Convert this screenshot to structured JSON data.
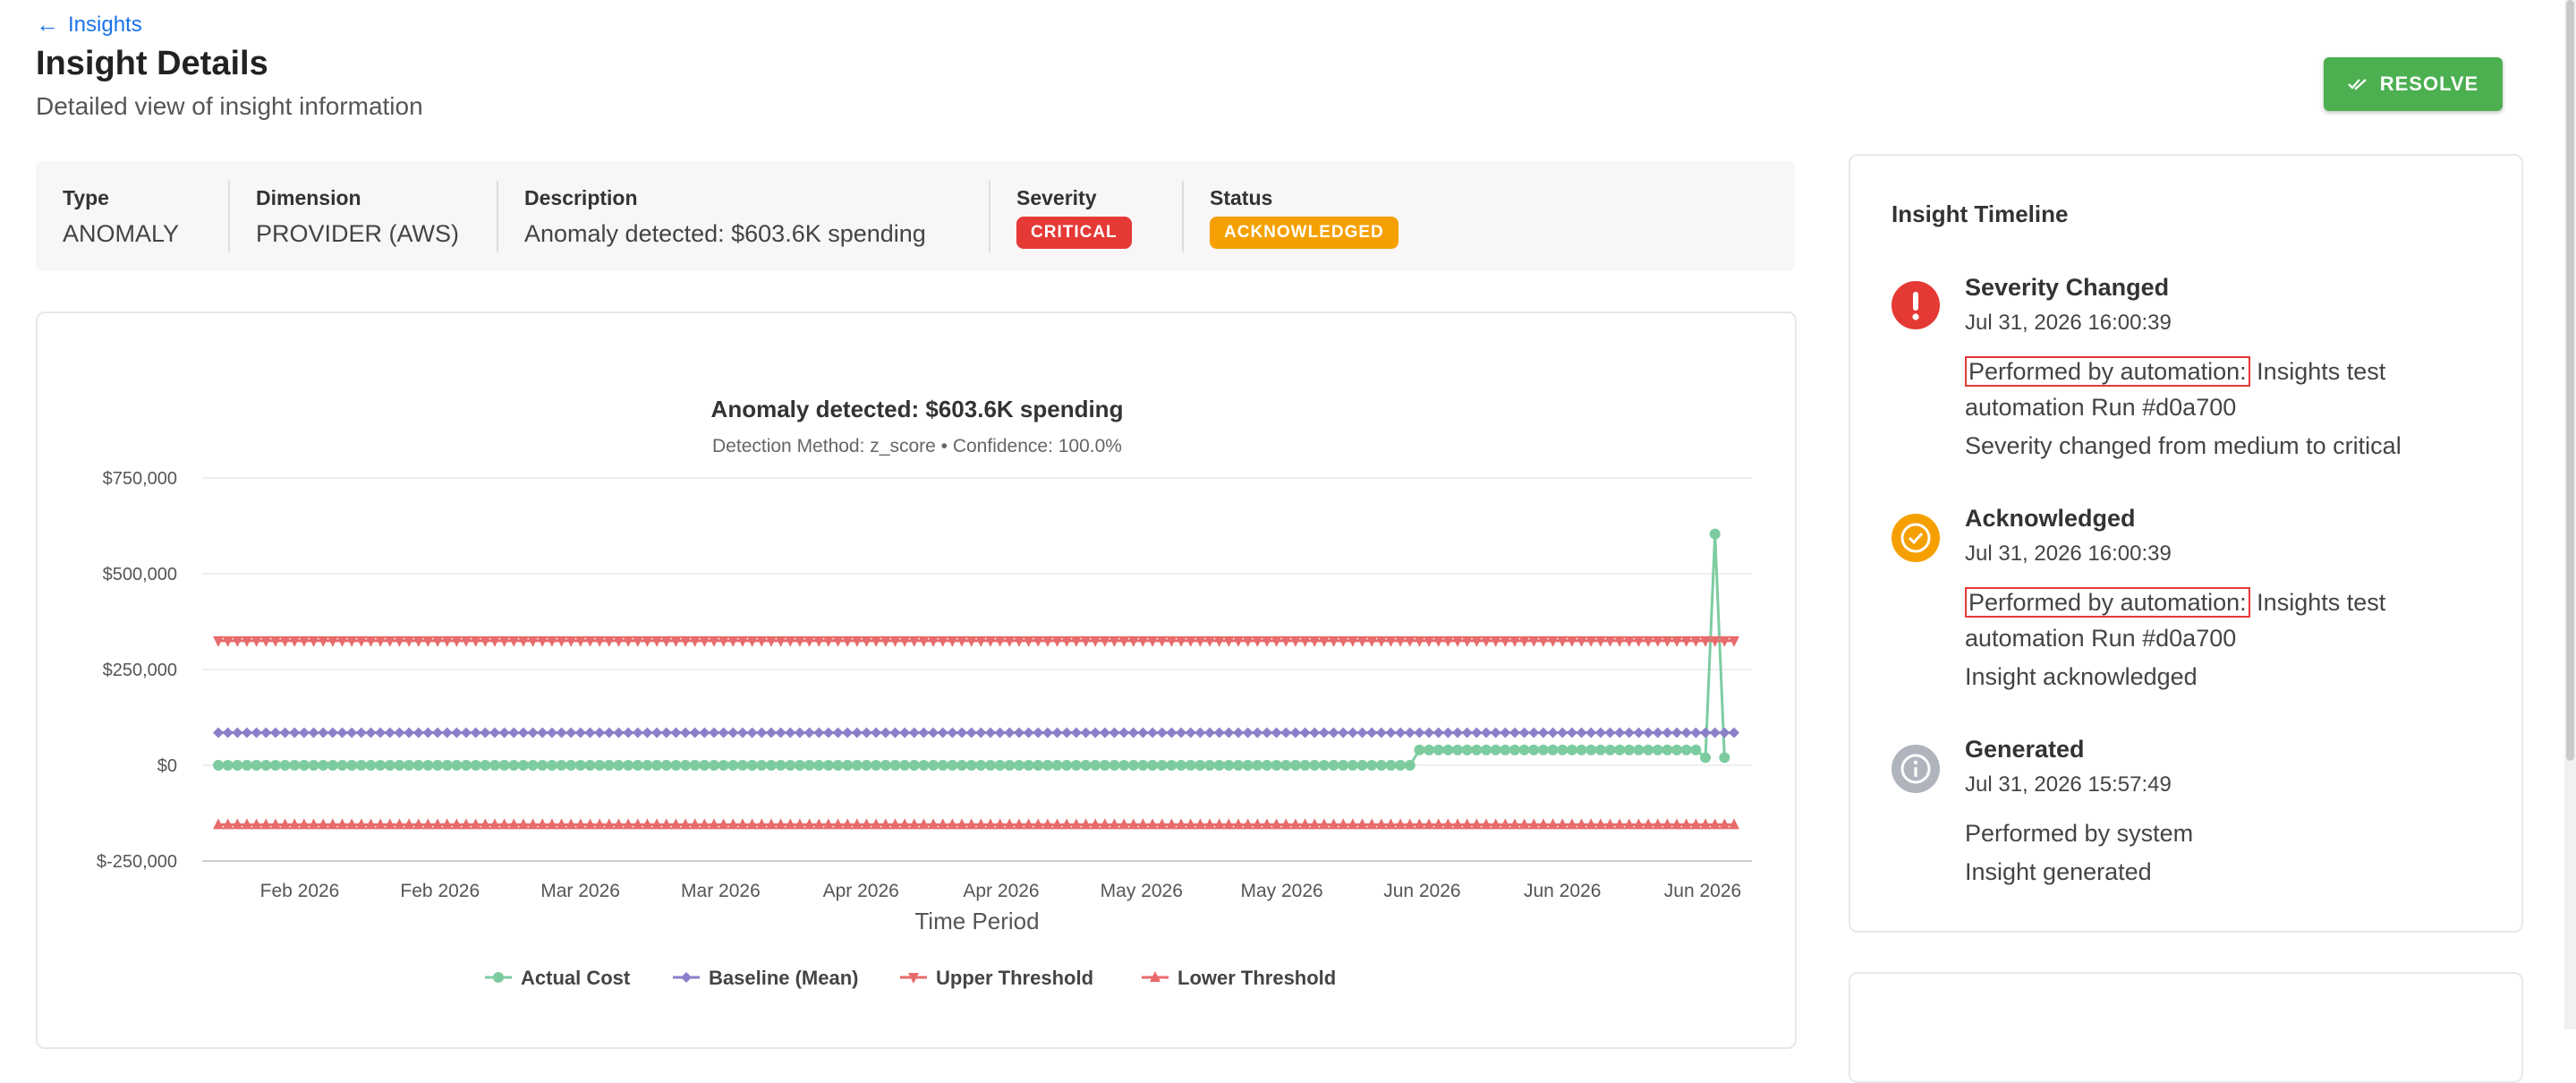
{
  "header": {
    "back_label": "Insights",
    "title": "Insight Details",
    "subtitle": "Detailed view of insight information",
    "resolve_label": "RESOLVE"
  },
  "info": {
    "type_label": "Type",
    "type_value": "ANOMALY",
    "dimension_label": "Dimension",
    "dimension_value": "PROVIDER (AWS)",
    "description_label": "Description",
    "description_value": "Anomaly detected: $603.6K spending",
    "severity_label": "Severity",
    "severity_value": "CRITICAL",
    "status_label": "Status",
    "status_value": "ACKNOWLEDGED"
  },
  "colors": {
    "critical": "#e53935",
    "acknowledged": "#f5a000",
    "resolve": "#4caf50",
    "actual": "#7dcca0",
    "baseline": "#8a80c9",
    "threshold": "#e86b6b",
    "system": "#b0b4bd"
  },
  "timeline": {
    "title": "Insight Timeline",
    "items": [
      {
        "event": "Severity Changed",
        "time": "Jul 31, 2026 16:00:39",
        "by_highlight": "Performed by automation:",
        "by_rest": " Insights test automation Run #d0a700",
        "message": "Severity changed from medium to critical",
        "icon": "exclamation-icon"
      },
      {
        "event": "Acknowledged",
        "time": "Jul 31, 2026 16:00:39",
        "by_highlight": "Performed by automation:",
        "by_rest": " Insights test automation Run #d0a700",
        "message": "Insight acknowledged",
        "icon": "check-circle-icon"
      },
      {
        "event": "Generated",
        "time": "Jul 31, 2026 15:57:49",
        "by_plain": "Performed by system",
        "message": "Insight generated",
        "icon": "info-icon"
      }
    ]
  },
  "chart_data": {
    "type": "line",
    "title": "Anomaly detected: $603.6K spending",
    "subtitle": "Detection Method: z_score • Confidence: 100.0%",
    "xlabel": "Time Period",
    "ylabel": "",
    "x_tick_labels": [
      "Feb 2026",
      "Feb 2026",
      "Mar 2026",
      "Mar 2026",
      "Apr 2026",
      "Apr 2026",
      "May 2026",
      "May 2026",
      "Jun 2026",
      "Jun 2026",
      "Jun 2026"
    ],
    "y_ticks": [
      750000,
      500000,
      250000,
      0,
      -250000
    ],
    "y_tick_labels": [
      "$750,000",
      "$500,000",
      "$250,000",
      "$0",
      "$-250,000"
    ],
    "ylim": [
      -250000,
      750000
    ],
    "grid": true,
    "legend_position": "bottom",
    "point_count": 160,
    "series": [
      {
        "name": "Actual Cost",
        "marker": "circle",
        "segments": [
          {
            "from_index": 0,
            "to_index": 125,
            "value": 0
          },
          {
            "from_index": 126,
            "to_index": 155,
            "value": 40000
          }
        ],
        "tail": [
          20000,
          603600,
          20000
        ]
      },
      {
        "name": "Baseline (Mean)",
        "marker": "diamond",
        "constant": 85000
      },
      {
        "name": "Upper Threshold",
        "marker": "triangle-down",
        "constant": 325000
      },
      {
        "name": "Lower Threshold",
        "marker": "triangle-up",
        "constant": -155000
      }
    ]
  }
}
